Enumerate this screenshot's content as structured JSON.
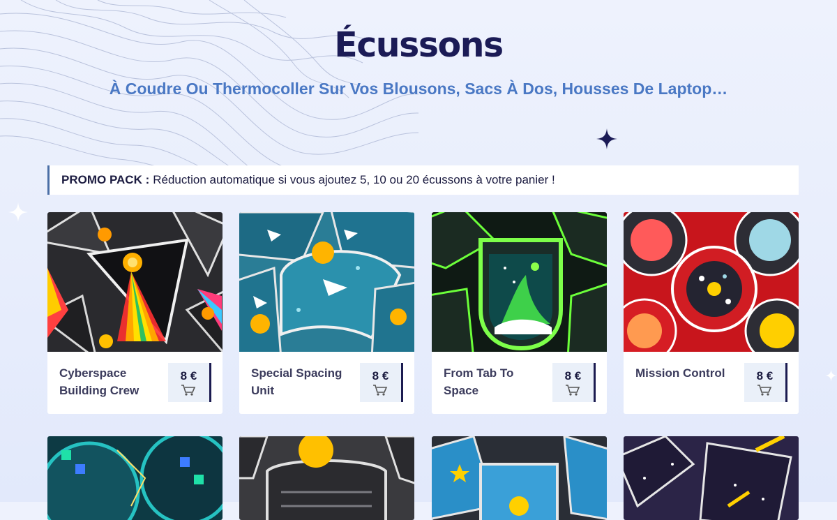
{
  "header": {
    "title": "Écussons",
    "subtitle": "À Coudre Ou Thermocoller Sur Vos Blousons, Sacs À Dos, Housses De Laptop…"
  },
  "promo": {
    "label": "PROMO PACK :",
    "text": "Réduction automatique si vous ajoutez 5, 10 ou 20 écussons à votre panier !"
  },
  "products": [
    {
      "name": "Cyberspace Building Crew",
      "price": "8 €",
      "image_icon": "cyberspace-patch-photo"
    },
    {
      "name": "Special Spacing Unit",
      "price": "8 €",
      "image_icon": "special-spacing-patch-photo"
    },
    {
      "name": "From Tab To Space",
      "price": "8 €",
      "image_icon": "tab-to-space-patch-photo"
    },
    {
      "name": "Mission Control",
      "price": "8 €",
      "image_icon": "mission-control-patch-photo"
    }
  ],
  "more_products": [
    {
      "image_icon": "prototype-team-patch-photo"
    },
    {
      "image_icon": "infrastructure-patch-photo"
    },
    {
      "image_icon": "style-class-patch-photo"
    },
    {
      "image_icon": "nobody-left-behind-patch-photo"
    }
  ],
  "colors": {
    "title": "#1b1b56",
    "subtitle": "#4a78c4",
    "price_box": "#eaf0f9",
    "accent_border": "#1b1b50"
  }
}
